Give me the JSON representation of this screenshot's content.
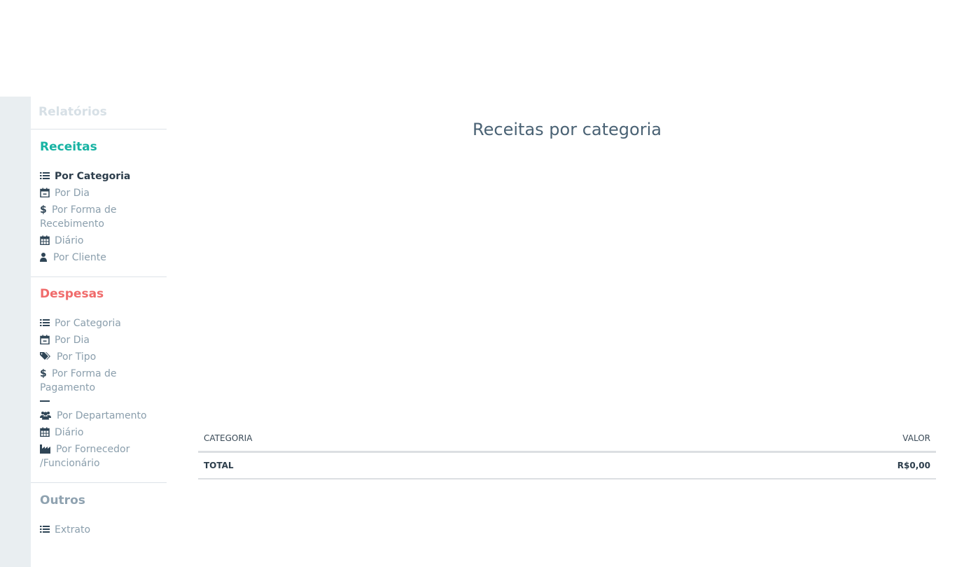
{
  "sidebar": {
    "title": "Relatórios",
    "receitas": {
      "title": "Receitas",
      "items": [
        {
          "label": "Por Categoria",
          "icon": "list-icon"
        },
        {
          "label": "Por Dia",
          "icon": "calendar-minus-icon"
        },
        {
          "label": "Por Forma de Recebimento",
          "icon": "dollar-icon"
        },
        {
          "label": "Diário",
          "icon": "calendar-icon"
        },
        {
          "label": "Por Cliente",
          "icon": "user-icon"
        }
      ]
    },
    "despesas": {
      "title": "Despesas",
      "items": [
        {
          "label": "Por Categoria",
          "icon": "list-icon"
        },
        {
          "label": "Por Dia",
          "icon": "calendar-minus-icon"
        },
        {
          "label": "Por Tipo",
          "icon": "tags-icon"
        },
        {
          "label": "Por Forma de Pagamento",
          "icon": "dollar-icon"
        },
        {
          "label": "Por Departamento",
          "icon": "users-icon"
        },
        {
          "label": "Diário",
          "icon": "calendar-icon"
        },
        {
          "label": "Por Fornecedor /Funcionário",
          "icon": "industry-icon"
        }
      ]
    },
    "outros": {
      "title": "Outros",
      "items": [
        {
          "label": "Extrato",
          "icon": "list-icon"
        }
      ]
    }
  },
  "main": {
    "title": "Receitas por categoria",
    "table": {
      "columns": [
        "CATEGORIA",
        "VALOR"
      ],
      "total_label": "TOTAL",
      "total_value": "R$0,00"
    }
  },
  "colors": {
    "receitas": "#17b3a3",
    "despesas": "#f06b6b",
    "outros": "#8fa2b0",
    "rail": "#e9eef1"
  }
}
